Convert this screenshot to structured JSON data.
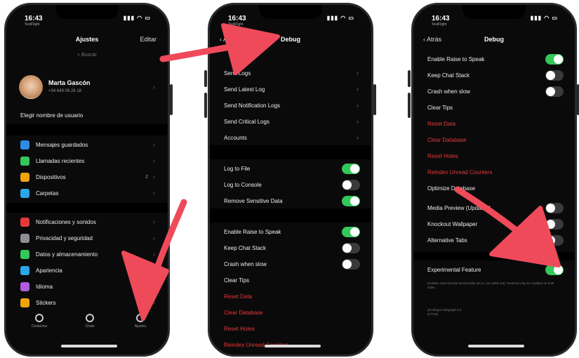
{
  "colors": {
    "accent_red": "#e5393a",
    "toggle_on": "#34c759",
    "arrow": "#ee4a5a"
  },
  "status": {
    "time": "16:43",
    "carrier": "TestFlight"
  },
  "phone1": {
    "title": "Ajustes",
    "edit": "Editar",
    "search_placeholder": "Buscar",
    "profile_name": "Marta Gascón",
    "profile_phone": "+34 649 09 26 18",
    "username": "Elegir nombre de usuario",
    "group1": [
      {
        "label": "Mensajes guardados",
        "icon": "bookmark-icon",
        "color": "#2f8be6"
      },
      {
        "label": "Llamadas recientes",
        "icon": "phone-icon",
        "color": "#34c759"
      },
      {
        "label": "Dispositivos",
        "badge": "2",
        "icon": "devices-icon",
        "color": "#f0a30a"
      },
      {
        "label": "Carpetas",
        "icon": "folder-icon",
        "color": "#2aa6e8"
      }
    ],
    "group2": [
      {
        "label": "Notificaciones y sonidos",
        "icon": "bell-icon",
        "color": "#e5393a"
      },
      {
        "label": "Privacidad y seguridad",
        "icon": "lock-icon",
        "color": "#8e8e93"
      },
      {
        "label": "Datos y almacenamiento",
        "icon": "data-icon",
        "color": "#34c759"
      },
      {
        "label": "Apariencia",
        "icon": "brush-icon",
        "color": "#2aa6e8"
      },
      {
        "label": "Idioma",
        "value": "Es",
        "icon": "globe-icon",
        "color": "#b05be0"
      },
      {
        "label": "Stickers",
        "icon": "sticker-icon",
        "color": "#f0a30a"
      }
    ],
    "tabs": [
      {
        "label": "Contactos"
      },
      {
        "label": "Chats"
      },
      {
        "label": "Ajustes"
      }
    ]
  },
  "phone2": {
    "back": "Ajustes",
    "title": "Debug",
    "group1": [
      {
        "label": "Send Logs"
      },
      {
        "label": "Send Latest Log"
      },
      {
        "label": "Send Notification Logs"
      },
      {
        "label": "Send Critical Logs"
      },
      {
        "label": "Accounts"
      }
    ],
    "group2": [
      {
        "label": "Log to File",
        "on": true
      },
      {
        "label": "Log to Console",
        "on": false
      },
      {
        "label": "Remove Sensitive Data",
        "on": true
      }
    ],
    "group3": [
      {
        "label": "Enable Raise to Speak",
        "on": true
      },
      {
        "label": "Keep Chat Stack",
        "on": false
      },
      {
        "label": "Crash when slow",
        "on": false
      },
      {
        "label": "Clear Tips"
      },
      {
        "label": "Reset Data",
        "red": true
      },
      {
        "label": "Clear Database",
        "red": true
      },
      {
        "label": "Reset Holes",
        "red": true
      },
      {
        "label": "Reindex Unread Counters",
        "red": true
      }
    ]
  },
  "phone3": {
    "back": "Atrás",
    "title": "Debug",
    "group1": [
      {
        "label": "Enable Raise to Speak",
        "on": true
      },
      {
        "label": "Keep Chat Stack",
        "on": false
      },
      {
        "label": "Crash when slow",
        "on": false
      },
      {
        "label": "Clear Tips"
      },
      {
        "label": "Reset Data",
        "red": true
      },
      {
        "label": "Clear Database",
        "red": true
      },
      {
        "label": "Reset Holes",
        "red": true
      },
      {
        "label": "Reindex Unread Counters",
        "red": true
      },
      {
        "label": "Optimize Database"
      }
    ],
    "group2": [
      {
        "label": "Media Preview (Updated)",
        "on": false
      },
      {
        "label": "Knockout Wallpaper",
        "on": false
      },
      {
        "label": "Alternative Tabs",
        "on": false
      }
    ],
    "experimental": {
      "label": "Experimental Feature",
      "on": true
    },
    "footer_note": "Enables experimental functionality (as in, not rolled out). Features may be enabled on both sides.",
    "version": "ph.telegra.Telegraph 6.3 (17735)"
  }
}
